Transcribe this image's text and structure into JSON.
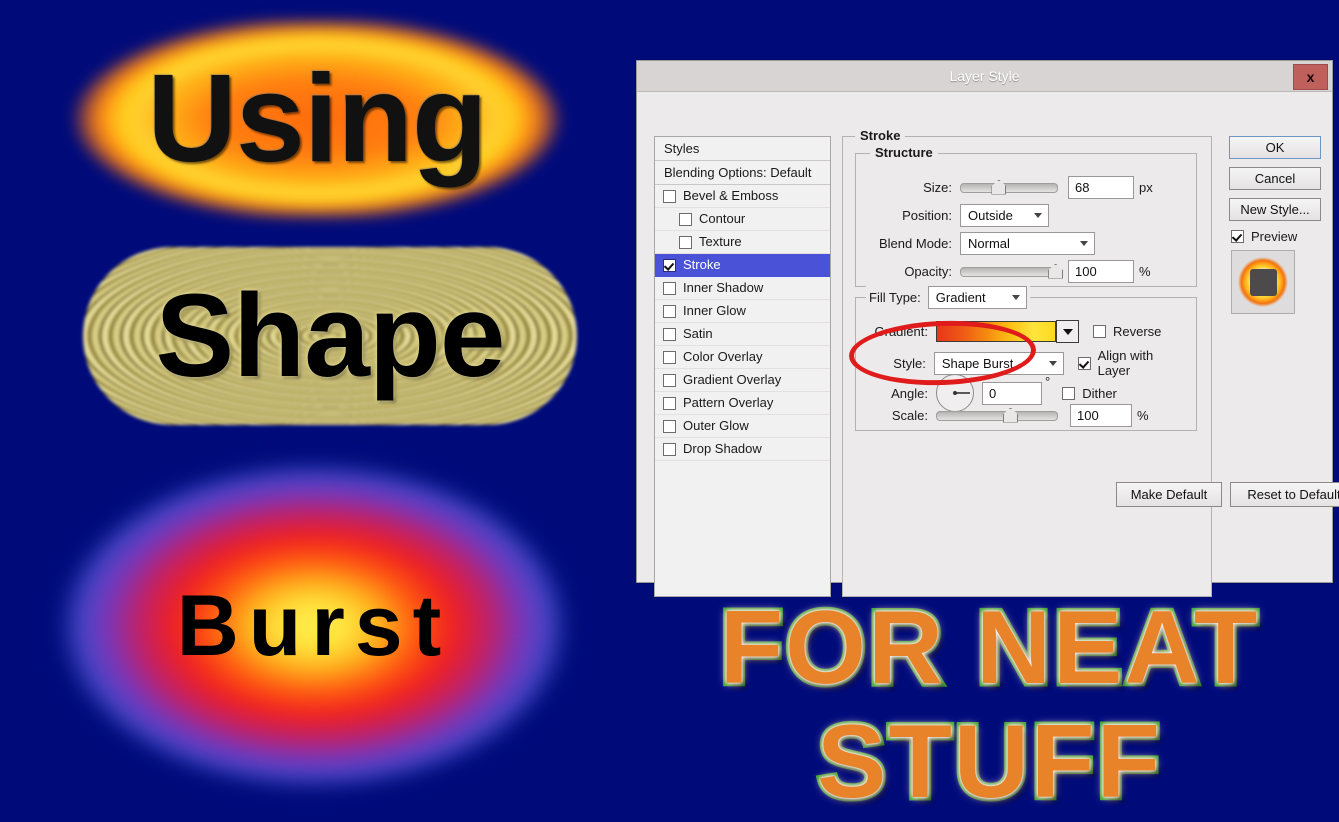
{
  "artwork": {
    "line1": "Using",
    "line2": "Shape",
    "line3": "Burst",
    "promo_line1": "FOR NEAT",
    "promo_line2": "STUFF",
    "background_color": "#000b7a"
  },
  "dialog": {
    "title": "Layer Style",
    "close_label": "x",
    "styles_panel": {
      "header": "Styles",
      "blending_options": "Blending Options: Default",
      "items": [
        {
          "label": "Bevel & Emboss",
          "checked": false,
          "sub": false,
          "selected": false
        },
        {
          "label": "Contour",
          "checked": false,
          "sub": true,
          "selected": false
        },
        {
          "label": "Texture",
          "checked": false,
          "sub": true,
          "selected": false
        },
        {
          "label": "Stroke",
          "checked": true,
          "sub": false,
          "selected": true
        },
        {
          "label": "Inner Shadow",
          "checked": false,
          "sub": false,
          "selected": false
        },
        {
          "label": "Inner Glow",
          "checked": false,
          "sub": false,
          "selected": false
        },
        {
          "label": "Satin",
          "checked": false,
          "sub": false,
          "selected": false
        },
        {
          "label": "Color Overlay",
          "checked": false,
          "sub": false,
          "selected": false
        },
        {
          "label": "Gradient Overlay",
          "checked": false,
          "sub": false,
          "selected": false
        },
        {
          "label": "Pattern Overlay",
          "checked": false,
          "sub": false,
          "selected": false
        },
        {
          "label": "Outer Glow",
          "checked": false,
          "sub": false,
          "selected": false
        },
        {
          "label": "Drop Shadow",
          "checked": false,
          "sub": false,
          "selected": false
        }
      ]
    },
    "stroke": {
      "group_label": "Stroke",
      "structure": {
        "group_label": "Structure",
        "size_label": "Size:",
        "size_value": "68",
        "size_unit": "px",
        "position_label": "Position:",
        "position_value": "Outside",
        "blend_mode_label": "Blend Mode:",
        "blend_mode_value": "Normal",
        "opacity_label": "Opacity:",
        "opacity_value": "100",
        "opacity_unit": "%"
      },
      "fill": {
        "fill_type_label": "Fill Type:",
        "fill_type_value": "Gradient",
        "gradient_label": "Gradient:",
        "gradient_colors": "#e8361a,#f58a10,#ffe53c",
        "reverse_label": "Reverse",
        "reverse_checked": false,
        "style_label": "Style:",
        "style_value": "Shape Burst",
        "align_label": "Align with Layer",
        "align_checked": true,
        "angle_label": "Angle:",
        "angle_value": "0",
        "angle_unit": "°",
        "dither_label": "Dither",
        "dither_checked": false,
        "scale_label": "Scale:",
        "scale_value": "100",
        "scale_unit": "%"
      },
      "make_default": "Make Default",
      "reset_to_default": "Reset to Default"
    },
    "buttons": {
      "ok": "OK",
      "cancel": "Cancel",
      "new_style": "New Style...",
      "preview_label": "Preview",
      "preview_checked": true
    },
    "annotation": {
      "color": "#e01b1b",
      "target": "Style: Shape Burst"
    }
  }
}
